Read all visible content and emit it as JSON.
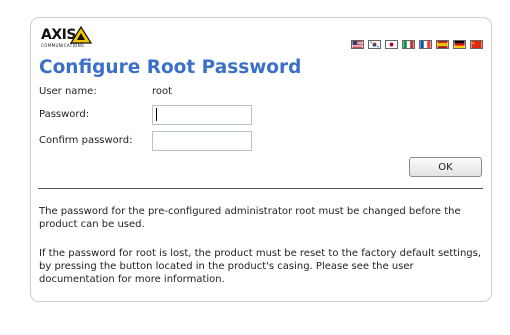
{
  "brand": {
    "logo_text": "AXIS",
    "logo_subtext": "COMMUNICATIONS",
    "accent": "#3c70c8",
    "logo_yellow": "#f5c400"
  },
  "languages": [
    {
      "name": "english",
      "colors": [
        "#b22234",
        "#ffffff",
        "#3c3b6e"
      ]
    },
    {
      "name": "korean",
      "colors": [
        "#ffffff",
        "#cd2e3a",
        "#0047a0"
      ]
    },
    {
      "name": "japanese",
      "colors": [
        "#ffffff",
        "#bc002d"
      ]
    },
    {
      "name": "italian",
      "colors": [
        "#009246",
        "#ffffff",
        "#ce2b37"
      ]
    },
    {
      "name": "french",
      "colors": [
        "#0055a4",
        "#ffffff",
        "#ef4135"
      ]
    },
    {
      "name": "spanish",
      "colors": [
        "#aa151b",
        "#f1bf00"
      ]
    },
    {
      "name": "german",
      "colors": [
        "#000000",
        "#dd0000",
        "#ffce00"
      ]
    },
    {
      "name": "chinese",
      "colors": [
        "#de2910",
        "#ffde00"
      ]
    }
  ],
  "page": {
    "title": "Configure Root Password"
  },
  "form": {
    "username_label": "User name:",
    "username_value": "root",
    "password_label": "Password:",
    "password_value": "",
    "confirm_label": "Confirm password:",
    "confirm_value": "",
    "ok_label": "OK"
  },
  "notes": {
    "paragraph1": "The password for the pre-configured administrator root must be changed before the product can be used.",
    "paragraph2": "If the password for root is lost, the product must be reset to the factory default settings, by pressing the button located in the product's casing. Please see the user documentation for more information."
  }
}
